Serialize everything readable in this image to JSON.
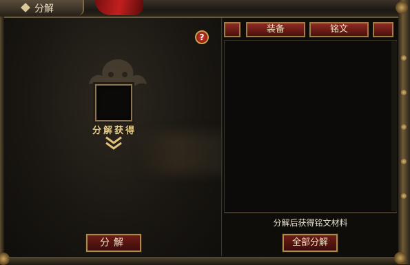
{
  "window": {
    "title": "分解"
  },
  "left_panel": {
    "help_label": "?",
    "obtain_label": "分解获得",
    "decompose_button": "分解"
  },
  "right_panel": {
    "tabs": [
      {
        "label": ""
      },
      {
        "label": "装备"
      },
      {
        "label": "铭文"
      },
      {
        "label": ""
      }
    ],
    "material_hint": "分解后获得铭文材料",
    "decompose_all_button": "全部分解"
  },
  "colors": {
    "button_fill": "#6e1c16",
    "button_border": "#b08a4a",
    "tab_fill": "#8e2a22",
    "help_fill": "#d23a2a",
    "label_gold": "#e7cc8a"
  },
  "icons": [
    "title-emblem-icon",
    "help-icon",
    "down-chevron-icon",
    "creature-emblem-icon"
  ]
}
